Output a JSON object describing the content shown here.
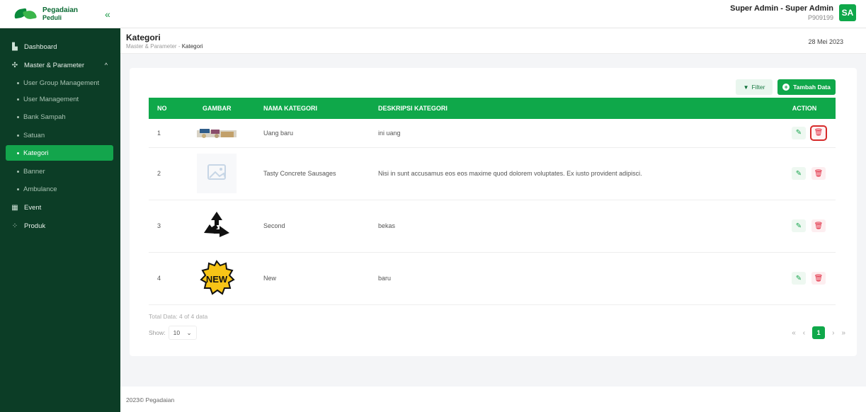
{
  "brand": {
    "name": "Pegadaian",
    "sub": "Peduli"
  },
  "header": {
    "collapse_icon": "«",
    "user_name": "Super Admin - Super Admin",
    "user_id": "P909199",
    "avatar": "SA"
  },
  "sidebar": {
    "dashboard": "Dashboard",
    "master": "Master & Parameter",
    "items": [
      "User Group Management",
      "User Management",
      "Bank Sampah",
      "Satuan",
      "Kategori",
      "Banner",
      "Ambulance"
    ],
    "event": "Event",
    "produk": "Produk"
  },
  "page": {
    "title": "Kategori",
    "breadcrumb_root": "Master & Parameter",
    "breadcrumb_sep": "-",
    "breadcrumb_current": "Kategori",
    "date": "28 Mei 2023"
  },
  "toolbar": {
    "filter": "Filter",
    "add": "Tambah Data"
  },
  "table": {
    "headers": {
      "no": "NO",
      "image": "GAMBAR",
      "name": "NAMA KATEGORI",
      "desc": "DESKRIPSI KATEGORI",
      "action": "ACTION"
    },
    "rows": [
      {
        "no": "1",
        "name": "Uang baru",
        "desc": "ini uang"
      },
      {
        "no": "2",
        "name": "Tasty Concrete Sausages",
        "desc": "Nisi in sunt accusamus eos eos maxime quod dolorem voluptates. Ex iusto provident adipisci."
      },
      {
        "no": "3",
        "name": "Second",
        "desc": "bekas"
      },
      {
        "no": "4",
        "name": "New",
        "desc": "baru"
      }
    ]
  },
  "footer_info": {
    "total": "Total Data: 4 of 4 data",
    "show_label": "Show:",
    "show_value": "10",
    "page": "1"
  },
  "pager_icons": {
    "first": "«",
    "prev": "‹",
    "next": "›",
    "last": "»"
  },
  "footer": "2023© Pegadaian",
  "colors": {
    "primary": "#0fa84a",
    "sidebar": "#0c3d26",
    "danger": "#e0263c"
  }
}
